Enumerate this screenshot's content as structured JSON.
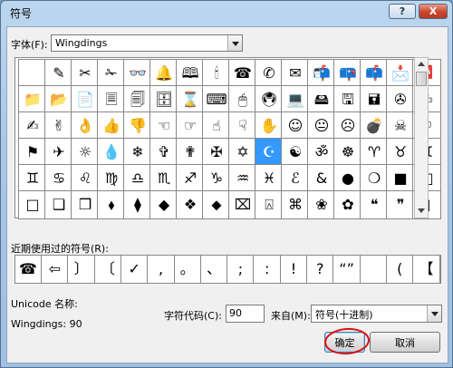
{
  "window": {
    "title": "符号",
    "help_label": "?",
    "close_label": "X"
  },
  "font_label": "字体(F):",
  "font_value": "Wingdings",
  "grid": {
    "rows": [
      [
        "",
        "✎",
        "✂",
        "✁",
        "👓",
        "🔔",
        "🕮",
        "🕯",
        "☎",
        "✆",
        "✉",
        "📬",
        "📪",
        "📫",
        "📩",
        "📮"
      ],
      [
        "📁",
        "📂",
        "📄",
        "🗏",
        "🗐",
        "🗄",
        "⌛",
        "⌨",
        "🖱",
        "🖲",
        "💻",
        "🖴",
        "🖫",
        "🖬",
        "✇",
        "✍"
      ],
      [
        "✍",
        "✌",
        "👌",
        "👍",
        "👎",
        "☜",
        "☞",
        "☝",
        "☟",
        "✋",
        "☺",
        "😐",
        "☹",
        "💣",
        "☠",
        "⚐"
      ],
      [
        "⚑",
        "✈",
        "☼",
        "💧",
        "❄",
        "✞",
        "✟",
        "✠",
        "✡",
        "☪",
        "☯",
        "ॐ",
        "☸",
        "♈",
        "♉",
        "♊"
      ],
      [
        "♊",
        "♋",
        "♌",
        "♍",
        "♎",
        "♏",
        "♐",
        "♑",
        "♒",
        "♓",
        "ℰ",
        "&",
        "●",
        "❍",
        "■",
        "□"
      ],
      [
        "□",
        "❑",
        "❒",
        "⬧",
        "⧫",
        "◆",
        "❖",
        "⬥",
        "⌧",
        "⍓",
        "⌘",
        "❀",
        "✿",
        "❝",
        "❞",
        "▯"
      ]
    ],
    "selected_char": "☪"
  },
  "recent_label": "近期使用过的符号(R):",
  "recent": [
    "☎",
    "⇦",
    "〕",
    "〔",
    "✓",
    ",",
    "。",
    "、",
    ";",
    ":",
    "!",
    "?",
    "“”",
    "",
    "(",
    "【"
  ],
  "unicode_name_label": "Unicode 名称:",
  "unicode_name_value": "Wingdings: 90",
  "char_code_label": "字符代码(C):",
  "char_code_value": "90",
  "from_label": "来自(M):",
  "from_value": "符号(十进制)",
  "ok_label": "确定",
  "cancel_label": "取消"
}
